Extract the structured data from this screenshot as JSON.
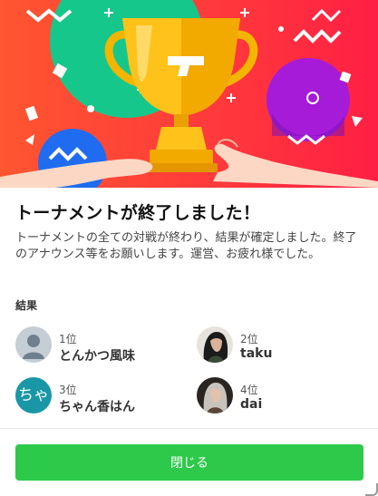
{
  "dialog": {
    "title": "トーナメントが終了しました！",
    "description": "トーナメントの全ての対戦が終わり、結果が確定しました。終了のアナウンス等をお願いします。運営、お疲れ様でした。",
    "results_label": "結果",
    "close_label": "閉じる"
  },
  "hero": {
    "icon": "trophy-illustration",
    "background_color": "#ff3b3b"
  },
  "results": [
    {
      "rank": "1位",
      "name": "とんかつ風味",
      "avatar": "default-user-icon"
    },
    {
      "rank": "2位",
      "name": "taku",
      "avatar": "character-portrait"
    },
    {
      "rank": "3位",
      "name": "ちゃん香はん",
      "avatar_text": "ちゃ"
    },
    {
      "rank": "4位",
      "name": "dai",
      "avatar": "character-portrait"
    }
  ],
  "colors": {
    "accent": "#2dc94a",
    "avatar_text_bg": "#1a97a6"
  }
}
